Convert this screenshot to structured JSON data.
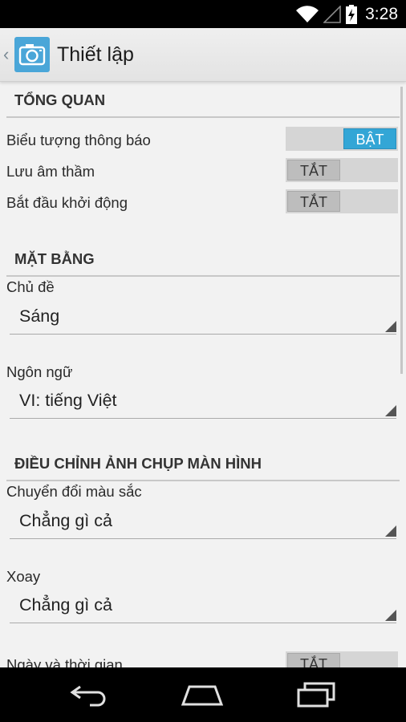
{
  "status_bar": {
    "time": "3:28"
  },
  "action_bar": {
    "title": "Thiết lập"
  },
  "sections": {
    "overview": {
      "header": "TỔNG QUAN",
      "notification_icon": {
        "label": "Biểu tượng thông báo",
        "state": "BẬT"
      },
      "silent_save": {
        "label": "Lưu âm thầm",
        "state": "TẮT"
      },
      "start_on_boot": {
        "label": "Bắt đầu khởi động",
        "state": "TẮT"
      }
    },
    "layout": {
      "header": "MẶT BẰNG",
      "theme": {
        "label": "Chủ đề",
        "value": "Sáng"
      },
      "language": {
        "label": "Ngôn ngữ",
        "value": "VI: tiếng Việt"
      }
    },
    "screenshot": {
      "header": "ĐIỀU CHỈNH ẢNH CHỤP MÀN HÌNH",
      "color_conversion": {
        "label": "Chuyển đổi màu sắc",
        "value": "Chẳng gì cả"
      },
      "rotate": {
        "label": "Xoay",
        "value": "Chẳng gì cả"
      },
      "date_time": {
        "label": "Ngày và thời gian",
        "state": "TẮT"
      }
    }
  },
  "colors": {
    "accent": "#33a6d6",
    "app_icon": "#4aa6d8"
  },
  "icons": [
    "wifi-icon",
    "signal-icon",
    "battery-charging-icon",
    "camera-icon",
    "back-icon",
    "home-icon",
    "recents-icon"
  ]
}
